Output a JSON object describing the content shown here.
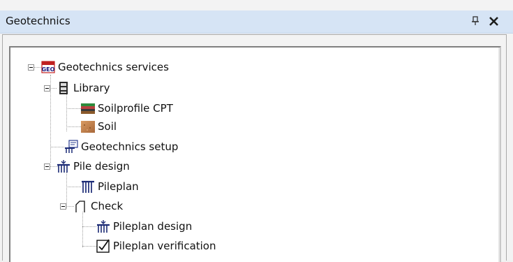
{
  "panel": {
    "title": "Geotechnics",
    "pin_icon": "pin-icon",
    "close_icon": "close-icon"
  },
  "tree": {
    "root": {
      "label": "Geotechnics services",
      "icon": "geo-icon"
    },
    "library": {
      "label": "Library",
      "icon": "library-icon"
    },
    "soilprofile": {
      "label": "Soilprofile CPT",
      "icon": "soilprofile-icon"
    },
    "soil": {
      "label": "Soil",
      "icon": "soil-icon"
    },
    "setup": {
      "label": "Geotechnics setup",
      "icon": "setup-icon"
    },
    "piledesign": {
      "label": "Pile design",
      "icon": "pile-design-icon"
    },
    "pileplan": {
      "label": "Pileplan",
      "icon": "pileplan-icon"
    },
    "check": {
      "label": "Check",
      "icon": "check-folder-icon"
    },
    "pileplandesign": {
      "label": "Pileplan design",
      "icon": "pileplan-design-icon"
    },
    "pileplanverification": {
      "label": "Pileplan verification",
      "icon": "checkbox-icon"
    }
  }
}
